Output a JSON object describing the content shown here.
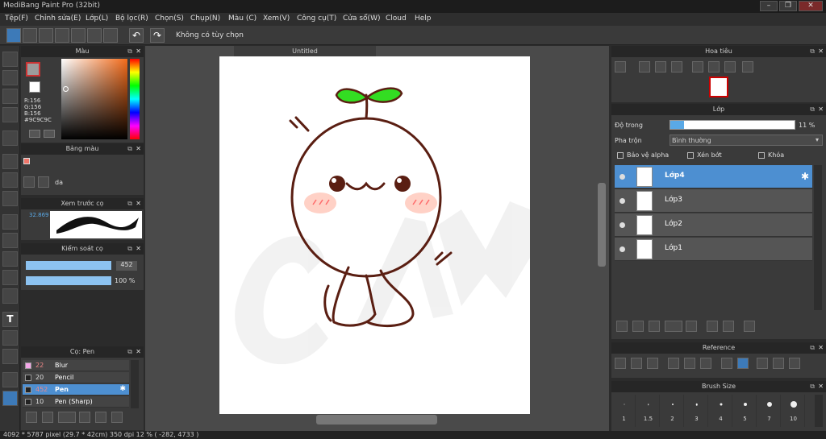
{
  "window": {
    "title": "MediBang Paint Pro (32bit)"
  },
  "menu": [
    "Tệp(F)",
    "Chỉnh sửa(E)",
    "Lớp(L)",
    "Bộ lọc(R)",
    "Chọn(S)",
    "Chụp(N)",
    "Màu (C)",
    "Xem(V)",
    "Công cụ(T)",
    "Cửa sổ(W)",
    "Cloud",
    "Help"
  ],
  "toolbar": {
    "option_text": "Không có tùy chọn"
  },
  "color_panel": {
    "title": "Màu",
    "r": "R:156",
    "g": "G:156",
    "b": "B:156",
    "hex": "#9C9C9C",
    "swatch_color": "#9c9c9c"
  },
  "palette_panel": {
    "title": "Bảng màu",
    "name": "da"
  },
  "preview_panel": {
    "title": "Xem trước cọ",
    "value": "32.869"
  },
  "brush_control": {
    "title": "Kiểm soát cọ",
    "size": "452",
    "opacity": "100 %"
  },
  "brush_panel": {
    "title": "Cọ: Pen",
    "items": [
      {
        "size": "22",
        "name": "Blur"
      },
      {
        "size": "20",
        "name": "Pencil"
      },
      {
        "size": "452",
        "name": "Pen"
      },
      {
        "size": "10",
        "name": "Pen (Sharp)"
      }
    ]
  },
  "canvas": {
    "tab": "Untitled"
  },
  "navigator": {
    "title": "Hoa tiêu"
  },
  "layer_panel": {
    "title": "Lớp",
    "opacity_label": "Độ trong",
    "opacity_value": "11 %",
    "opacity_fraction": 0.11,
    "blend_label": "Pha trộn",
    "blend_value": "Bình thường",
    "protect_alpha": "Bảo vệ alpha",
    "clipping": "Xén bớt",
    "lock": "Khóa",
    "layers": [
      "Lớp4",
      "Lớp3",
      "Lớp2",
      "Lớp1"
    ]
  },
  "reference_panel": {
    "title": "Reference"
  },
  "brush_size_panel": {
    "title": "Brush Size",
    "sizes": [
      "1",
      "1.5",
      "2",
      "3",
      "4",
      "5",
      "7",
      "10"
    ]
  },
  "status": {
    "text": "4092 * 5787 pixel   (29.7 * 42cm)   350 dpi   12 %   ( -282, 4733 )"
  }
}
